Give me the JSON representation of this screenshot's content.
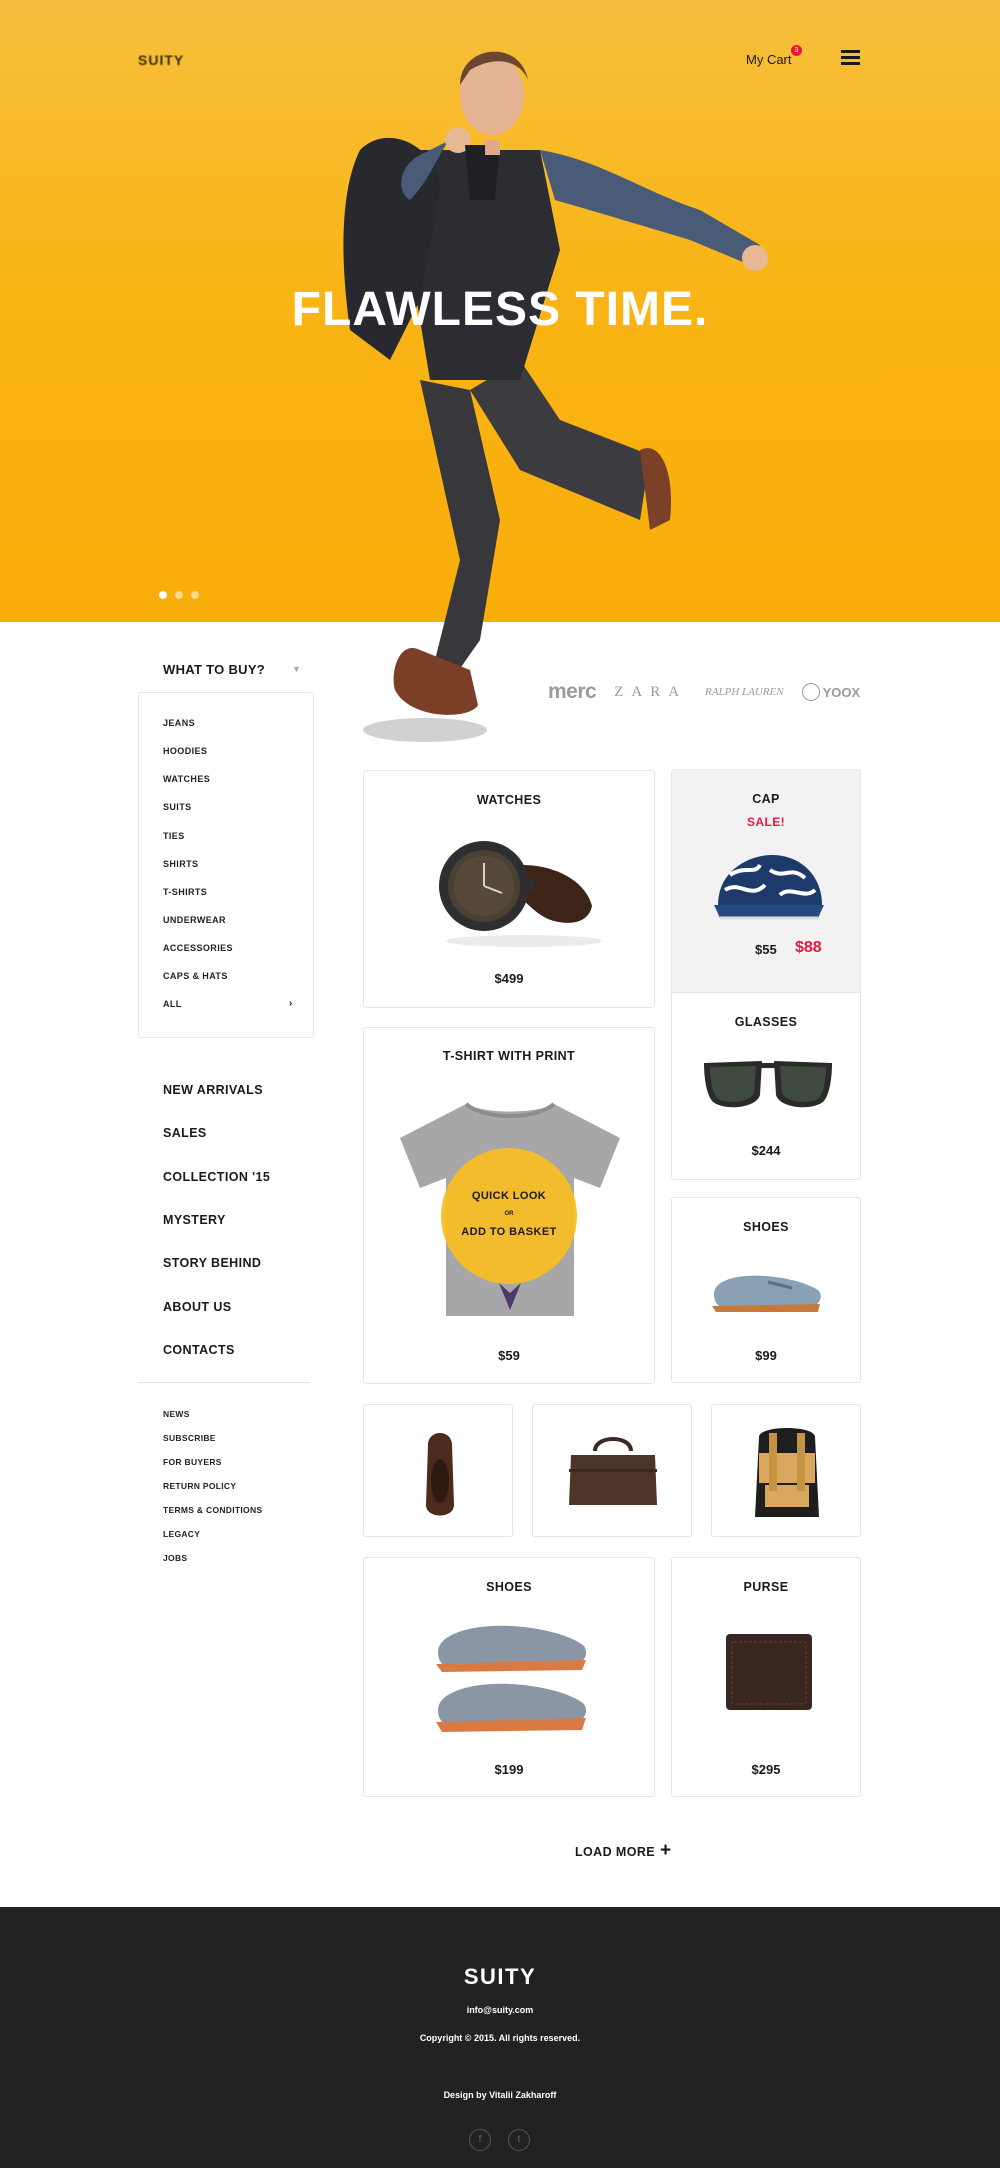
{
  "header": {
    "logo": "SUITY",
    "cart_label": "My Cart",
    "cart_count": "3",
    "headline": "FLAWLESS TIME.",
    "slider_pages": 3,
    "slider_active": 1
  },
  "sidebar": {
    "dropdown_label": "WHAT TO BUY?",
    "categories": [
      "JEANS",
      "HOODIES",
      "WATCHES",
      "SUITS",
      "TIES",
      "SHIRTS",
      "T-SHIRTS",
      "UNDERWEAR",
      "ACCESSORIES",
      "CAPS & HATS",
      "ALL"
    ],
    "main_nav": [
      "NEW ARRIVALS",
      "SALES",
      "COLLECTION '15",
      "MYSTERY",
      "STORY BEHIND",
      "ABOUT US",
      "CONTACTS"
    ],
    "sub_nav": [
      "NEWS",
      "SUBSCRIBE",
      "FOR BUYERS",
      "RETURN POLICY",
      "TERMS & CONDITIONS",
      "LEGACY",
      "JOBS"
    ]
  },
  "brands": [
    "merc",
    "ZARA",
    "RALPH LAUREN",
    "YOOX"
  ],
  "products": {
    "watches": {
      "title": "WATCHES",
      "price": "$499"
    },
    "cap": {
      "title": "CAP",
      "sale_label": "SALE!",
      "old_price": "$55",
      "new_price": "$88"
    },
    "tshirt": {
      "title": "T-SHIRT WITH PRINT",
      "price": "$59",
      "quick_look": "QUICK LOOK",
      "or": "OR",
      "add_to_basket": "ADD TO BASKET"
    },
    "glasses": {
      "title": "GLASSES",
      "price": "$244"
    },
    "shoes_small": {
      "title": "SHOES",
      "price": "$99"
    },
    "shoes_large": {
      "title": "SHOES",
      "price": "$199"
    },
    "purse": {
      "title": "PURSE",
      "price": "$295"
    }
  },
  "load_more": "LOAD MORE",
  "footer": {
    "brand": "SUITY",
    "email": "info@suity.com",
    "copyright": "Copyright © 2015. All rights reserved.",
    "credit": "Design by Vitalii Zakharoff",
    "social": [
      "facebook-icon",
      "twitter-icon"
    ]
  },
  "colors": {
    "hero_yellow": "#f9b516",
    "sale_red": "#e8183c",
    "footer_bg": "#222223",
    "quick_look_yellow": "#f6bd24"
  }
}
